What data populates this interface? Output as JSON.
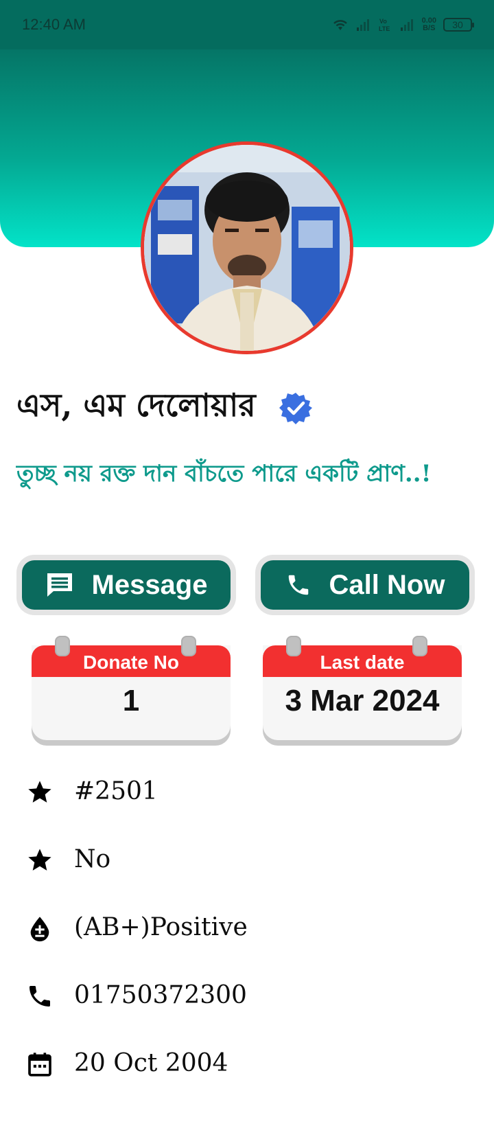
{
  "status_bar": {
    "time": "12:40 AM",
    "net_speed_value": "0.00",
    "net_speed_unit": "B/S",
    "battery": "30",
    "icons": [
      "wifi-icon",
      "signal-icon",
      "volte-icon",
      "signal-icon"
    ]
  },
  "profile": {
    "name": "এস, এম দেলোয়ার",
    "verified_icon": "verified-badge-icon",
    "quote": "তুচ্ছ নয় রক্ত দান বাঁচতে পারে একটি প্রাণ..!"
  },
  "actions": {
    "message_label": "Message",
    "call_label": "Call Now",
    "message_icon": "message-icon",
    "call_icon": "phone-icon"
  },
  "stats": {
    "donate_no_label": "Donate No",
    "donate_no_value": "1",
    "last_date_label": "Last date",
    "last_date_value": "3 Mar 2024"
  },
  "details": [
    {
      "icon": "star-icon",
      "text": "#2501"
    },
    {
      "icon": "star-icon",
      "text": "No"
    },
    {
      "icon": "blood-drop-icon",
      "text": "(AB+)Positive"
    },
    {
      "icon": "phone-icon",
      "text": "01750372300"
    },
    {
      "icon": "calendar-icon",
      "text": "20 Oct 2004"
    }
  ],
  "colors": {
    "header_dark": "#057566",
    "header_light": "#03e3c8",
    "button": "#0b6a5d",
    "calendar_red": "#f23030",
    "avatar_border": "#e83a2e",
    "quote": "#0e9a8c"
  }
}
